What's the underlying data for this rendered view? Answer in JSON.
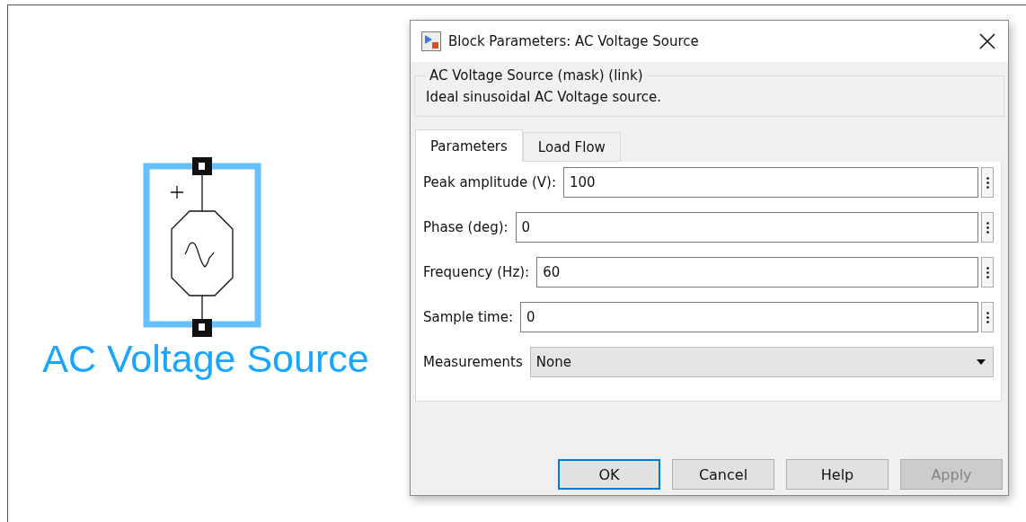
{
  "block": {
    "label": "AC Voltage Source",
    "selected": true
  },
  "dialog": {
    "title": "Block Parameters: AC Voltage Source",
    "group": {
      "legend": "AC Voltage Source (mask) (link)",
      "description": "Ideal sinusoidal AC Voltage source."
    },
    "tabs": [
      {
        "label": "Parameters",
        "selected": true
      },
      {
        "label": "Load Flow",
        "selected": false
      }
    ],
    "parameters": [
      {
        "kind": "edit",
        "label": "Peak amplitude (V):",
        "value": "100"
      },
      {
        "kind": "edit",
        "label": "Phase (deg):",
        "value": "0"
      },
      {
        "kind": "edit",
        "label": "Frequency (Hz):",
        "value": "60"
      },
      {
        "kind": "edit",
        "label": "Sample time:",
        "value": "0"
      },
      {
        "kind": "dropdown",
        "label": "Measurements",
        "value": "None"
      }
    ],
    "buttons": [
      {
        "label": "OK",
        "default": true,
        "disabled": false
      },
      {
        "label": "Cancel",
        "default": false,
        "disabled": false
      },
      {
        "label": "Help",
        "default": false,
        "disabled": false
      },
      {
        "label": "Apply",
        "default": false,
        "disabled": true
      }
    ]
  }
}
